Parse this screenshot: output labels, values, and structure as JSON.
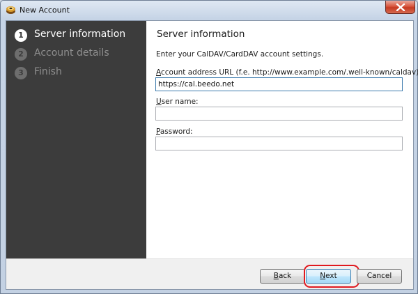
{
  "window": {
    "title": "New Account",
    "icon": "app-icon",
    "close_icon": "close-icon"
  },
  "sidebar": {
    "steps": [
      {
        "number": "1",
        "label": "Server information",
        "active": true
      },
      {
        "number": "2",
        "label": "Account details",
        "active": false
      },
      {
        "number": "3",
        "label": "Finish",
        "active": false
      }
    ]
  },
  "main": {
    "title": "Server information",
    "intro": "Enter your CalDAV/CardDAV account settings.",
    "url_label_prefix": "A",
    "url_label_rest": "ccount address URL (f.e. http://www.example.com/.well-known/caldav):",
    "url_value": "https://cal.beedo.net",
    "username_label_prefix": "U",
    "username_label_rest": "ser name:",
    "username_value": "",
    "password_label_prefix": "P",
    "password_label_rest": "assword:",
    "password_value": ""
  },
  "footer": {
    "back_prefix": "B",
    "back_rest": "ack",
    "next_prefix": "N",
    "next_rest": "ext",
    "cancel": "Cancel"
  },
  "colors": {
    "sidebar_bg": "#3c3c3c",
    "highlight": "#e0191f",
    "focus_border": "#3d7bad"
  }
}
